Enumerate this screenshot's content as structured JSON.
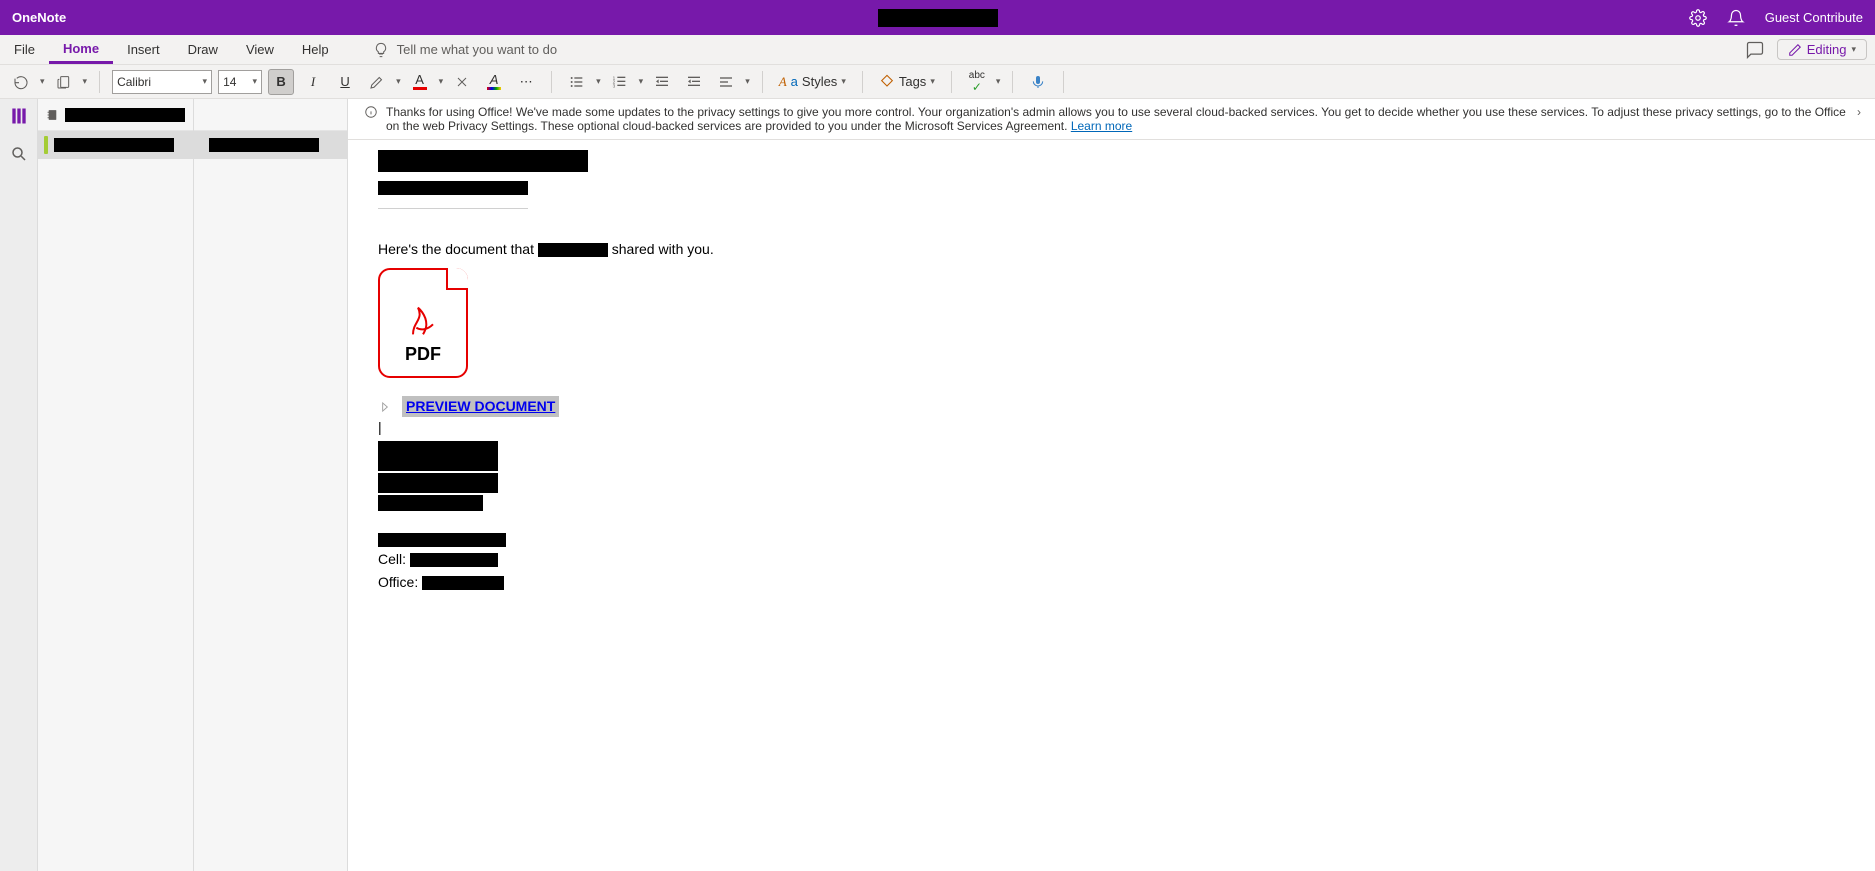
{
  "titlebar": {
    "app_name": "OneNote",
    "doc_title_redacted": "██████████████████",
    "account_label": "Guest Contribute"
  },
  "menubar": {
    "tabs": {
      "file": "File",
      "home": "Home",
      "insert": "Insert",
      "draw": "Draw",
      "view": "View",
      "help": "Help"
    },
    "tellme_placeholder": "Tell me what you want to do",
    "editing_label": "Editing"
  },
  "toolbar": {
    "font_family": "Calibri",
    "font_size": "14",
    "styles_label": "Styles",
    "tags_label": "Tags"
  },
  "nav": {
    "notebook_name_redacted": "██████████████",
    "section_name_redacted": "██████████████",
    "page_name_redacted": "██████████████"
  },
  "banner": {
    "text": "Thanks for using Office! We've made some updates to the privacy settings to give you more control. Your organization's admin allows you to use several cloud-backed services. You get to decide whether you use these services. To adjust these privacy settings, go to the Office on the web Privacy Settings. These optional cloud-backed services are provided to you under the Microsoft Services Agreement.",
    "learn_more": "Learn more"
  },
  "page": {
    "title_redacted": "███████████████████████",
    "subtitle_redacted": "██████████████████",
    "body_line_prefix": "Here's the document that",
    "body_line_mid_redacted": "█████████",
    "body_line_suffix": "shared with you.",
    "pdf_label": "PDF",
    "preview_link_label": "PREVIEW DOCUMENT",
    "sig_block": {
      "line1_redacted": "████████████",
      "line2_redacted": "████████████",
      "line3_redacted": "██████████",
      "line4_redacted": "█████████████",
      "cell_label": "Cell:",
      "cell_value_redacted": "█████████",
      "office_label": "Office:",
      "office_value_redacted": "████████"
    }
  }
}
